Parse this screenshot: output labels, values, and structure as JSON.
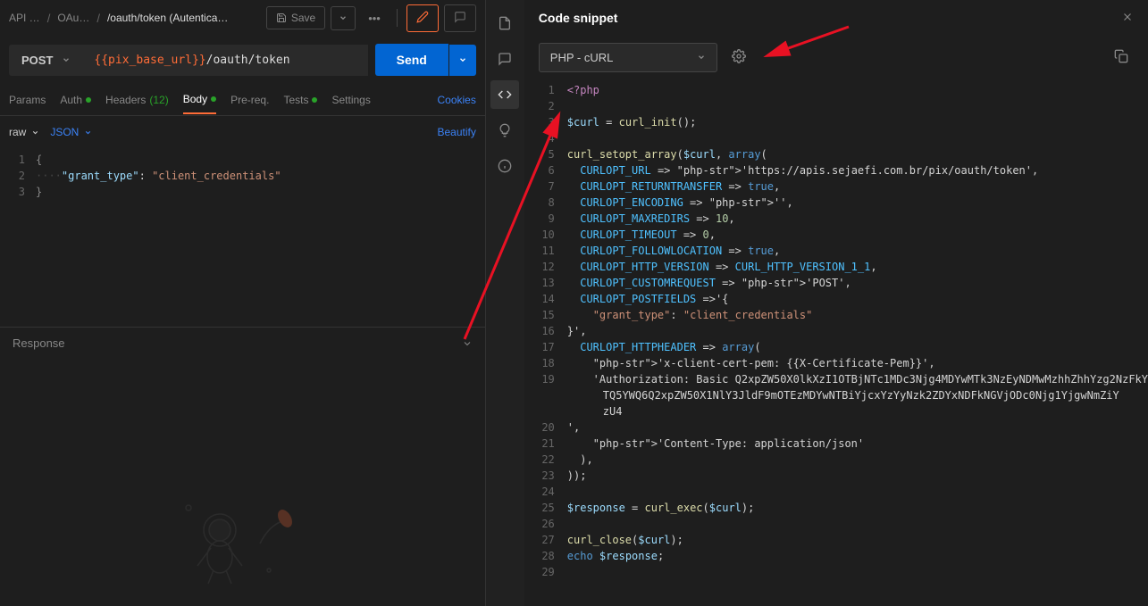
{
  "breadcrumb": {
    "c1": "API …",
    "c2": "OAu…",
    "c3": "/oauth/token (Autentica…"
  },
  "toolbar": {
    "save": "Save",
    "more": "ooo"
  },
  "request": {
    "method": "POST",
    "url_var": "{{pix_base_url}}",
    "url_rest": "/oauth/token",
    "send": "Send"
  },
  "tabs": {
    "params": "Params",
    "auth": "Auth",
    "headers": "Headers",
    "headers_count": "(12)",
    "body": "Body",
    "prereq": "Pre-req.",
    "tests": "Tests",
    "settings": "Settings",
    "cookies": "Cookies"
  },
  "bodyType": {
    "raw": "raw",
    "json": "JSON",
    "beautify": "Beautify"
  },
  "editor": {
    "l1": "{",
    "l2_key": "\"grant_type\"",
    "l2_val": "\"client_credentials\"",
    "l3": "}"
  },
  "response": {
    "label": "Response"
  },
  "snippet": {
    "title": "Code snippet",
    "lang": "PHP - cURL"
  },
  "code": {
    "lines": [
      "<?php",
      "",
      "$curl = curl_init();",
      "",
      "curl_setopt_array($curl, array(",
      "  CURLOPT_URL => 'https://apis.sejaefi.com.br/pix/oauth/token',",
      "  CURLOPT_RETURNTRANSFER => true,",
      "  CURLOPT_ENCODING => '',",
      "  CURLOPT_MAXREDIRS => 10,",
      "  CURLOPT_TIMEOUT => 0,",
      "  CURLOPT_FOLLOWLOCATION => true,",
      "  CURLOPT_HTTP_VERSION => CURL_HTTP_VERSION_1_1,",
      "  CURLOPT_CUSTOMREQUEST => 'POST',",
      "  CURLOPT_POSTFIELDS =>'{",
      "    \"grant_type\": \"client_credentials\"",
      "}',",
      "  CURLOPT_HTTPHEADER => array(",
      "    'x-client-cert-pem: {{X-Certificate-Pem}}',",
      "    'Authorization: Basic Q2xpZW50X0lkXzI1OTBjNTc1MDc3Njg4MDYwMTk3NzEyNDMwMzhhZhhYzg2NzFkYTQ5YWQ6Q2xpZW50X1NlY3JldF9mOTEzMDYwNTBiYjcxYzYyNzk2ZDYxNDFkNGVjODc0Njg1YjgwNmZiYzU4",
      "',",
      "    'Content-Type: application/json'",
      "  ),",
      "));",
      "",
      "$response = curl_exec($curl);",
      "",
      "curl_close($curl);",
      "echo $response;",
      ""
    ]
  }
}
